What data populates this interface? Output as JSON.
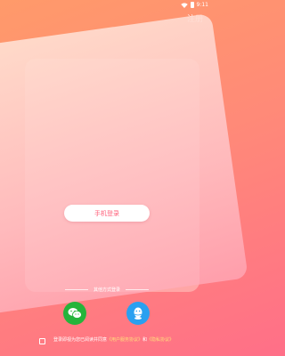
{
  "status_bar": {
    "time": "9:11"
  },
  "header": {
    "register_label": "注册"
  },
  "main": {
    "phone_login_label": "手机登录"
  },
  "other_login": {
    "label": "其他方式登录"
  },
  "agreement": {
    "prefix": "登录即视为您已阅读并同意",
    "user_agreement": "《用户服务协议》",
    "and": "和",
    "privacy_policy": "《隐私协议》"
  },
  "colors": {
    "accent": "#ff5f79",
    "wechat": "#25b43b",
    "qq": "#2aa0f0"
  },
  "icons": {
    "wechat": "wechat-icon",
    "qq": "qq-icon"
  }
}
